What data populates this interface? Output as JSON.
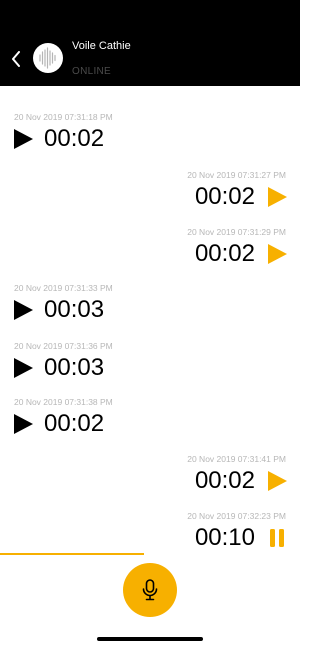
{
  "header": {
    "contact_name": "Voile Cathie",
    "status": "ONLINE",
    "back_icon": "chevron-left-icon",
    "avatar_icon": "waveform-avatar"
  },
  "colors": {
    "accent": "#f7b000",
    "header_bg": "#000000",
    "timestamp": "#b7b7b7"
  },
  "messages": [
    {
      "side": "left",
      "timestamp": "20 Nov 2019 07:31:18 PM",
      "duration": "00:02",
      "control": "play"
    },
    {
      "side": "right",
      "timestamp": "20 Nov 2019 07:31:27 PM",
      "duration": "00:02",
      "control": "play"
    },
    {
      "side": "right",
      "timestamp": "20 Nov 2019 07:31:29 PM",
      "duration": "00:02",
      "control": "play"
    },
    {
      "side": "left",
      "timestamp": "20 Nov 2019 07:31:33 PM",
      "duration": "00:03",
      "control": "play"
    },
    {
      "side": "left",
      "timestamp": "20 Nov 2019 07:31:36 PM",
      "duration": "00:03",
      "control": "play"
    },
    {
      "side": "left",
      "timestamp": "20 Nov 2019 07:31:38 PM",
      "duration": "00:02",
      "control": "play"
    },
    {
      "side": "right",
      "timestamp": "20 Nov 2019 07:31:41 PM",
      "duration": "00:02",
      "control": "play"
    },
    {
      "side": "right",
      "timestamp": "20 Nov 2019 07:32:23 PM",
      "duration": "00:10",
      "control": "pause"
    }
  ],
  "playback": {
    "progress": 0.48
  },
  "record": {
    "icon": "microphone-icon"
  }
}
